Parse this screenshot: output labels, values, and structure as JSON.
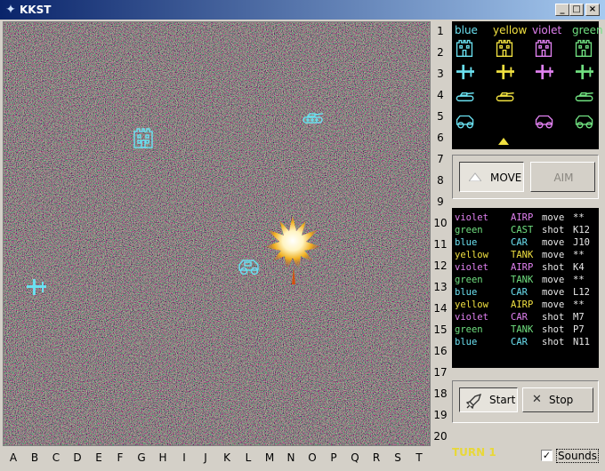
{
  "window": {
    "title": "KKST",
    "min": "_",
    "max": "□",
    "close": "×"
  },
  "colors": {
    "blue": "#6ae0f0",
    "yellow": "#f0e040",
    "violet": "#e080f0",
    "green": "#70e080",
    "white": "#e8e8e8"
  },
  "field": {
    "units": [
      {
        "name": "blue-castle-unit",
        "icon": "castle-icon",
        "color": "#6ae0f0"
      },
      {
        "name": "blue-tank-unit",
        "icon": "tank-icon",
        "color": "#6ae0f0"
      },
      {
        "name": "blue-car-unit",
        "icon": "car-icon",
        "color": "#6ae0f0"
      },
      {
        "name": "blue-airplane-unit",
        "icon": "airplane-icon",
        "color": "#6ae0f0"
      }
    ],
    "explosion": "explosion-icon"
  },
  "rows": [
    "1",
    "2",
    "3",
    "4",
    "5",
    "6",
    "7",
    "8",
    "9",
    "10",
    "11",
    "12",
    "13",
    "14",
    "15",
    "16",
    "17",
    "18",
    "19",
    "20"
  ],
  "columns": [
    "A",
    "B",
    "C",
    "D",
    "E",
    "F",
    "G",
    "H",
    "I",
    "J",
    "K",
    "L",
    "M",
    "N",
    "O",
    "P",
    "Q",
    "R",
    "S",
    "T"
  ],
  "legend": {
    "players": [
      {
        "label": "blue",
        "color": "#6ae0f0"
      },
      {
        "label": "yellow",
        "color": "#f0e040"
      },
      {
        "label": "violet",
        "color": "#e080f0"
      },
      {
        "label": "green",
        "color": "#70e080"
      }
    ],
    "selected_player": "yellow"
  },
  "controls": {
    "move_label": "MOVE",
    "aim_label": "AIM",
    "start_label": "Start",
    "stop_label": "Stop"
  },
  "log": [
    {
      "player": "violet",
      "unit": "AIRP",
      "action": "move",
      "target": "**"
    },
    {
      "player": "green",
      "unit": "CAST",
      "action": "shot",
      "target": "K12"
    },
    {
      "player": "blue",
      "unit": "CAR",
      "action": "move",
      "target": "J10"
    },
    {
      "player": "yellow",
      "unit": "TANK",
      "action": "move",
      "target": "**"
    },
    {
      "player": "violet",
      "unit": "AIRP",
      "action": "shot",
      "target": "K4"
    },
    {
      "player": "green",
      "unit": "TANK",
      "action": "move",
      "target": "**"
    },
    {
      "player": "blue",
      "unit": "CAR",
      "action": "move",
      "target": "L12"
    },
    {
      "player": "yellow",
      "unit": "AIRP",
      "action": "move",
      "target": "**"
    },
    {
      "player": "violet",
      "unit": "CAR",
      "action": "shot",
      "target": "M7"
    },
    {
      "player": "green",
      "unit": "TANK",
      "action": "shot",
      "target": "P7"
    },
    {
      "player": "blue",
      "unit": "CAR",
      "action": "shot",
      "target": "N11"
    }
  ],
  "status": {
    "turn_label": "TURN 1",
    "sounds_label": "Sounds",
    "sounds_checked": true
  }
}
